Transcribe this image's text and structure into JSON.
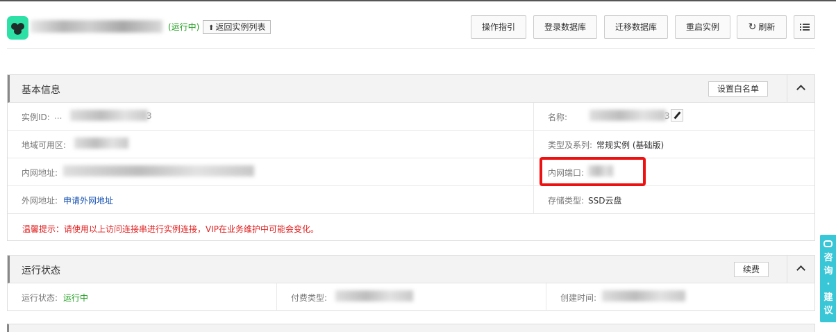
{
  "header": {
    "status": "(运行中)",
    "back_label": "返回实例列表",
    "buttons": {
      "guide": "操作指引",
      "login_db": "登录数据库",
      "migrate_db": "迁移数据库",
      "restart": "重启实例",
      "refresh": "刷新"
    }
  },
  "basic_info": {
    "title": "基本信息",
    "whitelist_button": "设置白名单",
    "instance_id_label": "实例ID:",
    "instance_id_prefix": "...",
    "instance_id_suffix": "3",
    "name_label": "名称:",
    "name_suffix": "3",
    "region_label": "地域可用区:",
    "type_label": "类型及系列:",
    "type_value": "常规实例 (基础版)",
    "intranet_addr_label": "内网地址:",
    "intranet_port_label": "内网端口:",
    "public_addr_label": "外网地址:",
    "public_addr_link": "申请外网地址",
    "storage_label": "存储类型:",
    "storage_value": "SSD云盘",
    "warning": "温馨提示：请使用以上访问连接串进行实例连接，VIP在业务维护中可能会变化。"
  },
  "run_status": {
    "title": "运行状态",
    "renew_button": "续费",
    "status_label": "运行状态:",
    "status_value": "运行中",
    "billing_label": "付费类型:",
    "created_label": "创建时间:"
  },
  "side_tab": {
    "text": "咨询·建议"
  },
  "colors": {
    "accent_green": "#2ce0a6",
    "running_green": "#1a9a1a",
    "link_blue": "#1a55b5",
    "warning_red": "#e02020",
    "highlight_red": "#ee1111",
    "side_tab": "#39c6d6"
  },
  "icons": [
    "instance-logo-icon",
    "up-arrow-icon",
    "refresh-icon",
    "list-menu-icon",
    "chevron-up-icon",
    "edit-pencil-icon",
    "chat-icon"
  ]
}
